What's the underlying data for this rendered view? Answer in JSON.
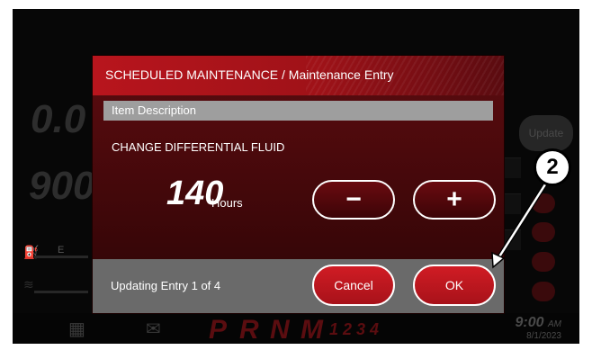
{
  "background": {
    "gauge_top": "0.0",
    "gauge_bottom": "900",
    "update_label": "Update",
    "fuel_letter": "E"
  },
  "bottom_bar": {
    "gears": [
      "P",
      "R",
      "N",
      "M"
    ],
    "gear_numbers": "1 2 3 4",
    "time": "9:00",
    "ampm": "AM",
    "date": "8/1/2023"
  },
  "dialog": {
    "title": "SCHEDULED MAINTENANCE / Maintenance Entry",
    "section_header": "Item Description",
    "item_description": "CHANGE DIFFERENTIAL FLUID",
    "hours_value": "140",
    "hours_label": "Hours",
    "minus_label": "−",
    "plus_label": "+",
    "status": "Updating Entry 1 of 4",
    "cancel_label": "Cancel",
    "ok_label": "OK"
  },
  "callout": {
    "number": "2"
  },
  "colors": {
    "accent_red": "#b8151d",
    "footer_gray": "#6a6a6a",
    "header_gray": "#9e9e9e"
  }
}
